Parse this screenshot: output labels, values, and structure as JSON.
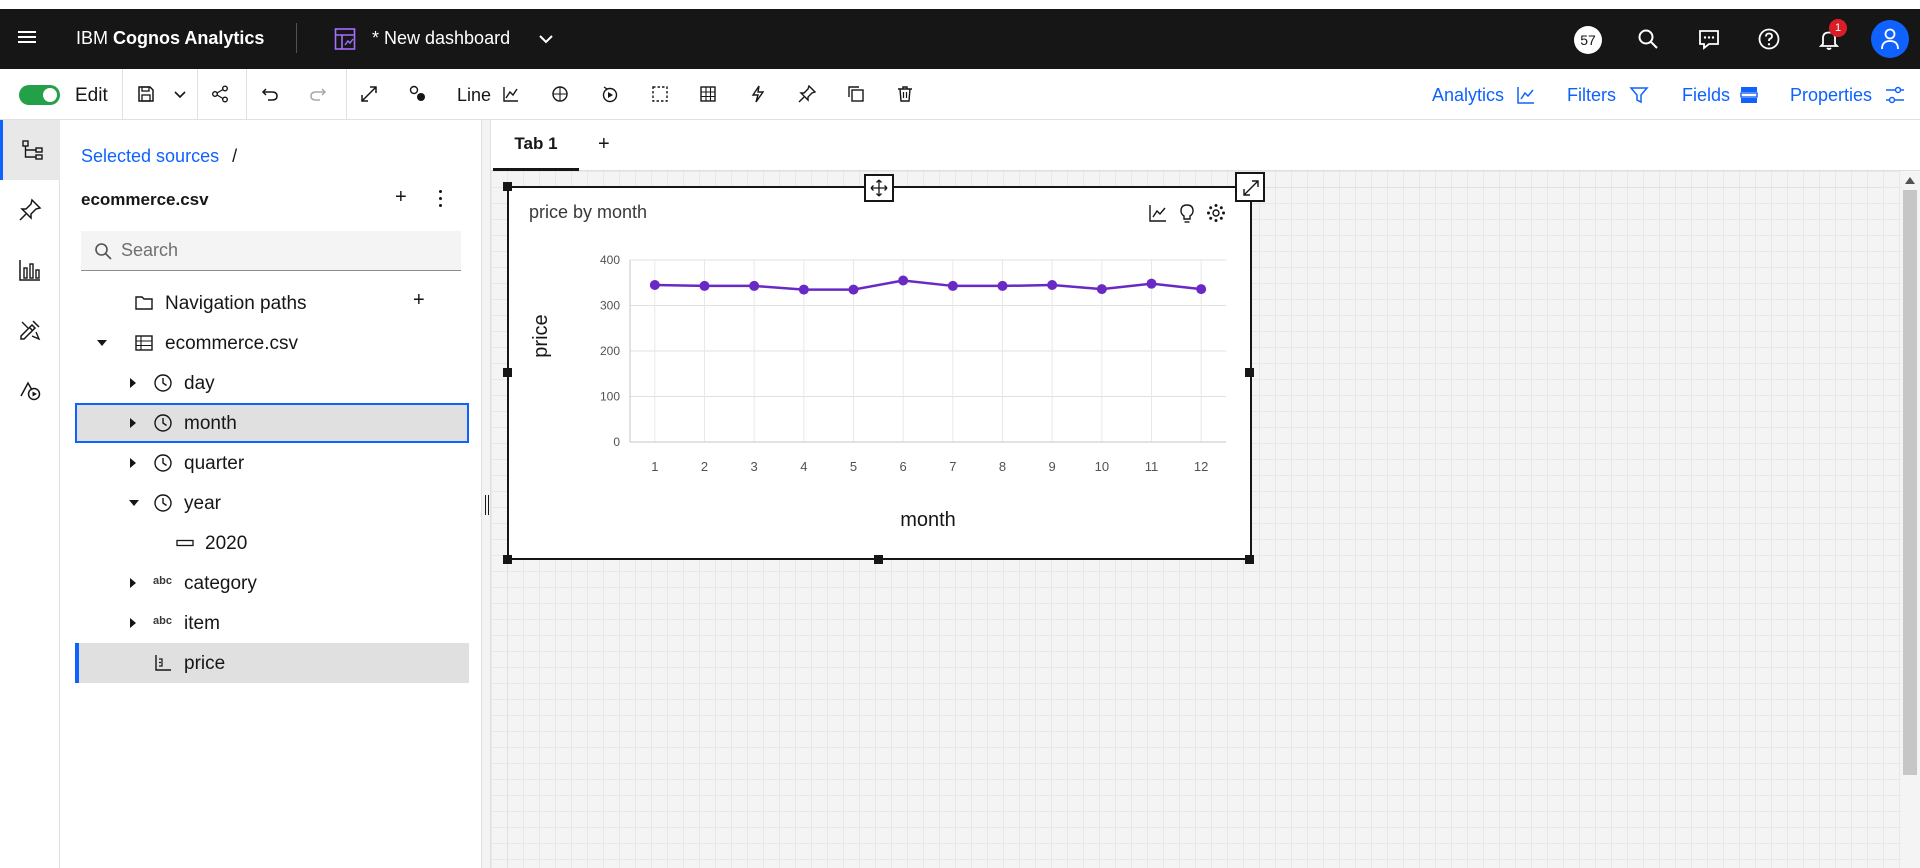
{
  "topbar": {
    "brand_prefix": "IBM",
    "brand_name": "Cognos Analytics",
    "dashboard_title": "* New dashboard",
    "count_badge": "57",
    "notification_count": "1"
  },
  "toolbar": {
    "edit_label": "Edit",
    "visualization_label": "Line",
    "analytics_label": "Analytics",
    "filters_label": "Filters",
    "fields_label": "Fields",
    "properties_label": "Properties"
  },
  "sources": {
    "breadcrumb_link": "Selected sources",
    "breadcrumb_sep": "/",
    "source_name": "ecommerce.csv",
    "search_placeholder": "Search",
    "tree": [
      {
        "label": "Navigation paths",
        "icon": "folder-icon"
      },
      {
        "label": "ecommerce.csv",
        "icon": "table-icon"
      },
      {
        "label": "day",
        "icon": "clock-icon"
      },
      {
        "label": "month",
        "icon": "clock-icon"
      },
      {
        "label": "quarter",
        "icon": "clock-icon"
      },
      {
        "label": "year",
        "icon": "clock-icon"
      },
      {
        "label": "2020",
        "icon": "member-icon"
      },
      {
        "label": "category",
        "icon": "abc-icon",
        "type_label": "abc"
      },
      {
        "label": "item",
        "icon": "abc-icon",
        "type_label": "abc"
      },
      {
        "label": "price",
        "icon": "measure-icon"
      }
    ]
  },
  "tabs": [
    {
      "label": "Tab 1"
    }
  ],
  "tab_add_label": "+",
  "widget": {
    "title": "price by month"
  },
  "colors": {
    "accent": "#0f62fe",
    "series": "#6929c4",
    "toggle_on": "#24a148",
    "notification": "#da1e28"
  },
  "chart_data": {
    "type": "line",
    "categories": [
      "1",
      "2",
      "3",
      "4",
      "5",
      "6",
      "7",
      "8",
      "9",
      "10",
      "11",
      "12"
    ],
    "series": [
      {
        "values": [
          345,
          343,
          343,
          335,
          335,
          355,
          343,
          343,
          345,
          336,
          348,
          336
        ]
      }
    ],
    "xlabel": "month",
    "ylabel": "price",
    "ylim": [
      0,
      400
    ],
    "yticks": [
      0,
      100,
      200,
      300,
      400
    ],
    "grid": true,
    "legend": "none"
  }
}
